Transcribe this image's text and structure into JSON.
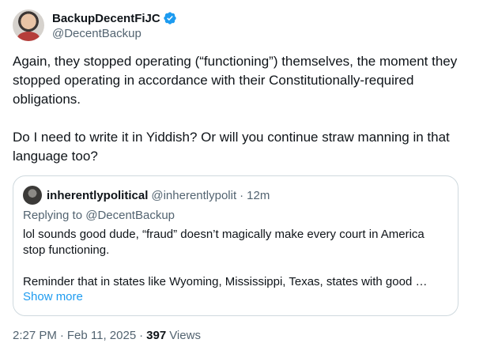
{
  "author": {
    "display_name": "BackupDecentFiJC",
    "handle": "@DecentBackup",
    "verified_icon": "verified-badge-icon",
    "accent": "#1d9bf0"
  },
  "tweet": {
    "text": "Again, they stopped operating (“functioning”) themselves, the moment they stopped operating in accordance with their Constitutionally-required obligations.\n\nDo I need to write it in Yiddish? Or will you continue straw manning in that language too?"
  },
  "quote": {
    "display_name": "inherentlypolitical",
    "handle": "@inherentlypolit",
    "separator": "·",
    "time": "12m",
    "replying_to_prefix": "Replying to",
    "replying_to_handle": "@DecentBackup",
    "text": "lol sounds good dude, “fraud” doesn’t magically make every court in America stop functioning.\n\nReminder that in states like Wyoming, Mississippi, Texas, states with good …",
    "show_more": "Show more"
  },
  "meta": {
    "time": "2:27 PM",
    "separator": "·",
    "date": "Feb 11, 2025",
    "separator2": "·",
    "views_count": "397",
    "views_label": "Views"
  }
}
